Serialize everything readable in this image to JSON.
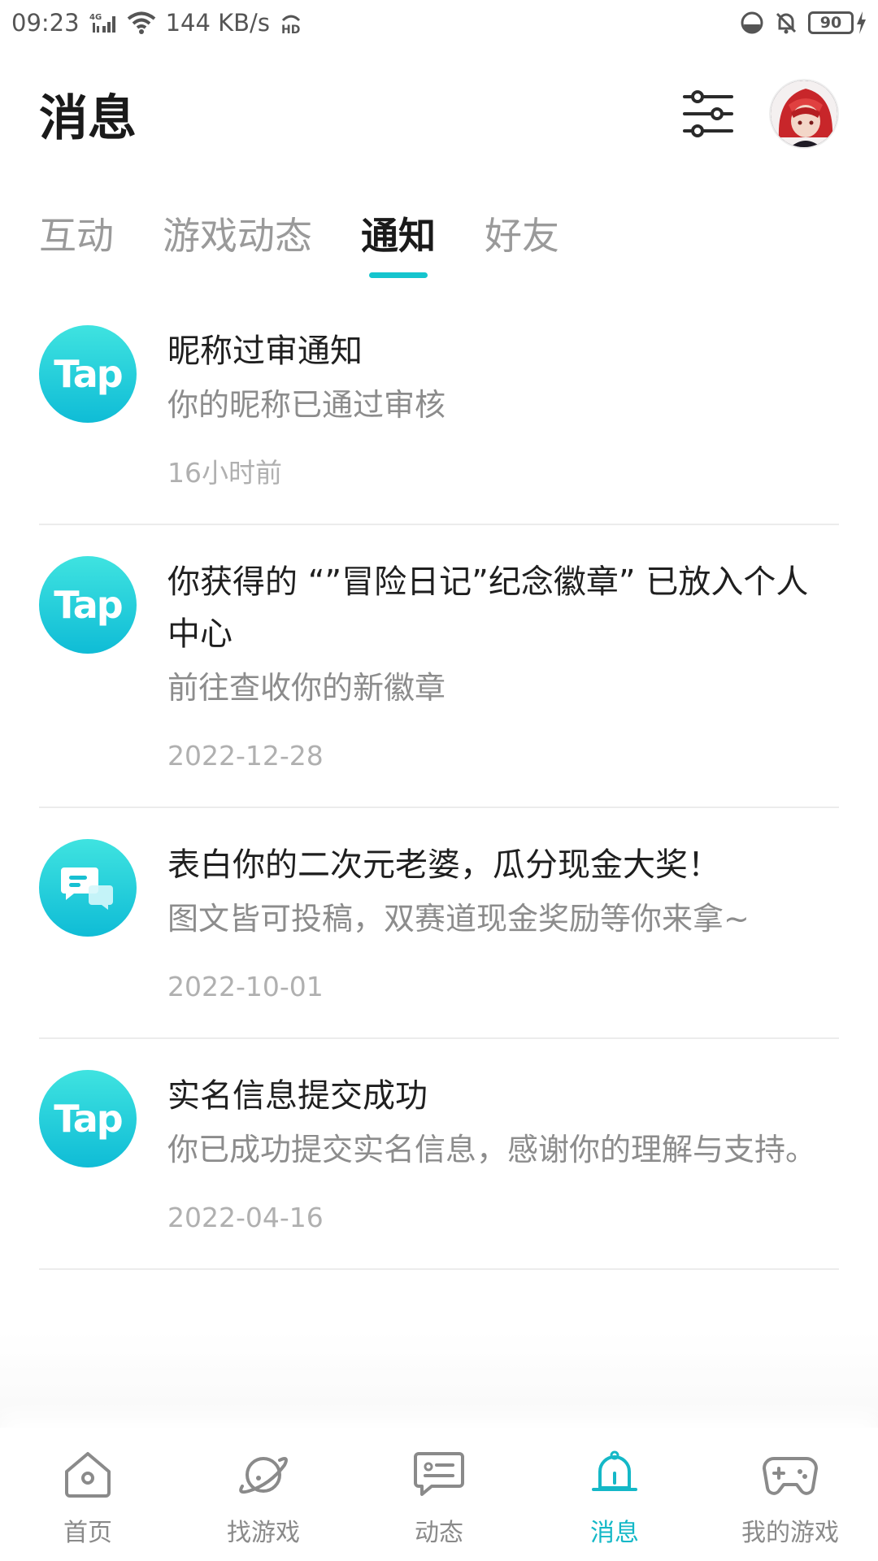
{
  "status_bar": {
    "time": "09:23",
    "network": "4G",
    "speed": "144 KB/s",
    "hd": "HD",
    "battery": "90",
    "icons": [
      "signal-icon",
      "wifi-icon",
      "hd-icon",
      "do-not-disturb-icon",
      "bell-off-icon",
      "battery-icon",
      "charging-icon"
    ]
  },
  "header": {
    "title": "消息",
    "filter_icon": "sliders-icon",
    "avatar": "user-avatar"
  },
  "tabs": [
    {
      "label": "互动",
      "active": false
    },
    {
      "label": "游戏动态",
      "active": false
    },
    {
      "label": "通知",
      "active": true
    },
    {
      "label": "好友",
      "active": false
    }
  ],
  "accent_color": "#15c5ce",
  "notifications": [
    {
      "icon": "Tap",
      "icon_type": "tap-logo-icon",
      "title": "昵称过审通知",
      "desc": "你的昵称已通过审核",
      "time": "16小时前"
    },
    {
      "icon": "Tap",
      "icon_type": "tap-logo-icon",
      "title": "你获得的 “”冒险日记”纪念徽章” 已放入个人中心",
      "desc": "前往查收你的新徽章",
      "time": "2022-12-28"
    },
    {
      "icon": "",
      "icon_type": "chat-bubble-icon",
      "title": "表白你的二次元老婆，瓜分现金大奖！",
      "desc": "图文皆可投稿，双赛道现金奖励等你来拿~",
      "time": "2022-10-01"
    },
    {
      "icon": "Tap",
      "icon_type": "tap-logo-icon",
      "title": "实名信息提交成功",
      "desc": "你已成功提交实名信息，感谢你的理解与支持。",
      "time": "2022-04-16"
    }
  ],
  "bottom_nav": [
    {
      "label": "首页",
      "icon": "home-icon",
      "active": false
    },
    {
      "label": "找游戏",
      "icon": "planet-icon",
      "active": false
    },
    {
      "label": "动态",
      "icon": "feed-icon",
      "active": false
    },
    {
      "label": "消息",
      "icon": "bell-icon",
      "active": true
    },
    {
      "label": "我的游戏",
      "icon": "gamepad-icon",
      "active": false
    }
  ]
}
